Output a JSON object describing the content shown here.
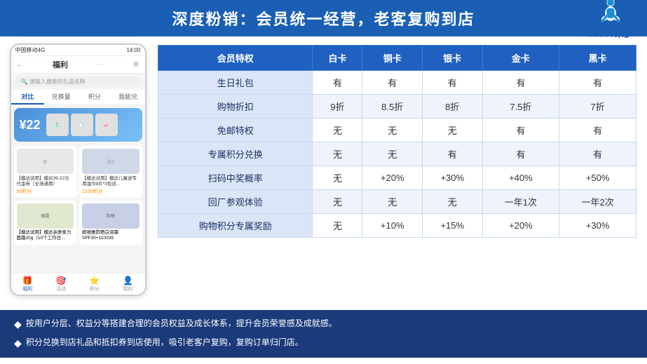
{
  "header": {
    "title": "深度粉销：会员统一经营，老客复购到店",
    "logo_alt": "midoo米多"
  },
  "phone": {
    "status_bar": "中国移动4G",
    "time": "14:00",
    "nav_title": "福利",
    "search_placeholder": "请输入搜索的礼品名称",
    "tabs": [
      "对比",
      "兑换量",
      "积分",
      "我能兑"
    ],
    "active_tab": 0,
    "coupon_amount": "¥22",
    "product1_name": "模达39-22元代金券（全场通用）",
    "product1_points": "50积分",
    "product2_name": "模达儿童送专用湿巾8片*3包适...",
    "product2_points": "2100积分",
    "product3_name": "【模达试用】模达亲肤柔力面霜20g（10个工作日...",
    "product4_name": "妮维雅防晒白润霜SPF30+110039",
    "bottom_nav": [
      "福利",
      "活动",
      "积分",
      "我的"
    ],
    "active_bottom": 0
  },
  "table": {
    "headers": [
      "会员特权",
      "白卡",
      "铜卡",
      "银卡",
      "金卡",
      "黑卡"
    ],
    "rows": [
      [
        "生日礼包",
        "有",
        "有",
        "有",
        "有",
        "有"
      ],
      [
        "购物折扣",
        "9折",
        "8.5折",
        "8折",
        "7.5折",
        "7折"
      ],
      [
        "免邮特权",
        "无",
        "无",
        "无",
        "有",
        "有"
      ],
      [
        "专属积分兑换",
        "无",
        "无",
        "有",
        "有",
        "有"
      ],
      [
        "扫码中奖概率",
        "无",
        "+20%",
        "+30%",
        "+40%",
        "+50%"
      ],
      [
        "回厂参观体验",
        "无",
        "无",
        "无",
        "一年1次",
        "一年2次"
      ],
      [
        "购物积分专属奖励",
        "无",
        "+10%",
        "+15%",
        "+20%",
        "+30%"
      ]
    ]
  },
  "footer": {
    "items": [
      "按用户分层、权益分等搭建合理的会员权益及成长体系，提升会员荣誉感及成就感。",
      "积分兑换到店礼品和抵扣券到店使用，吸引老客户复购，复购订单归门店。"
    ]
  }
}
